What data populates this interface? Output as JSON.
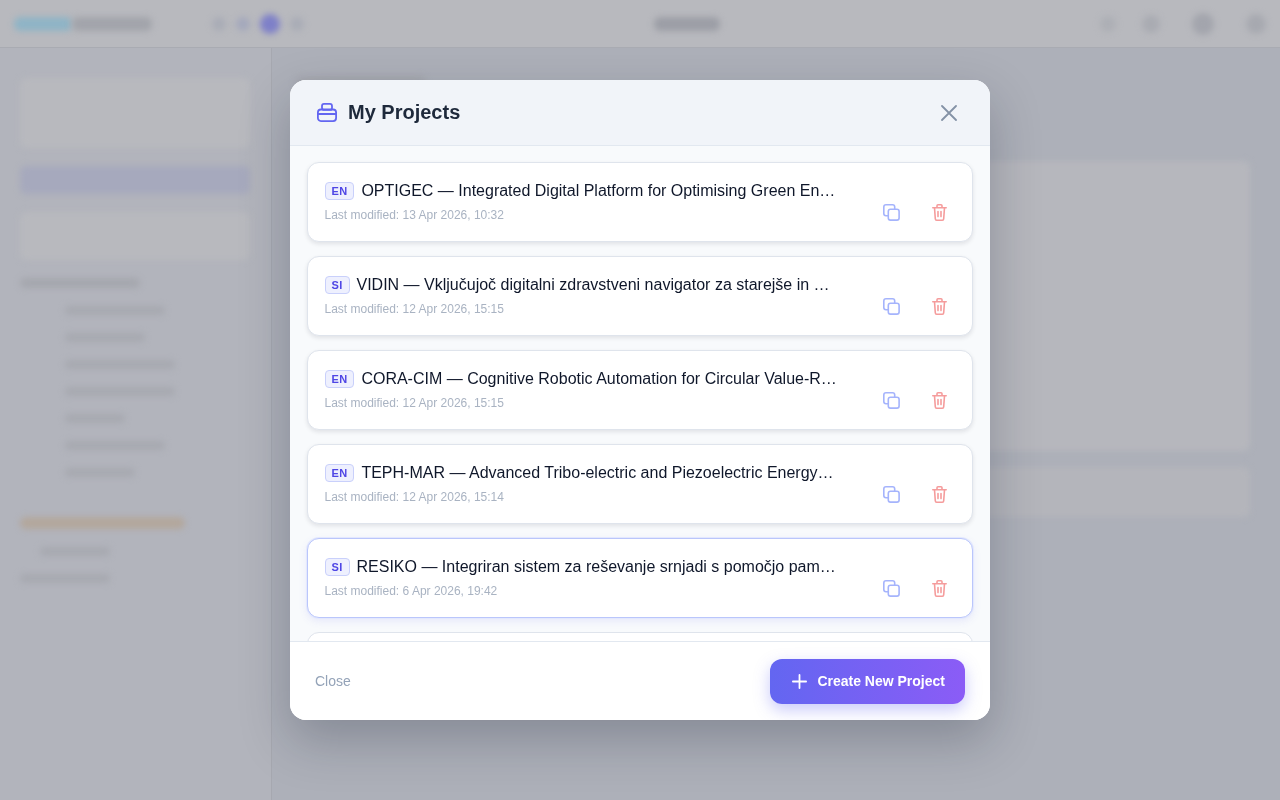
{
  "dialog": {
    "title": "My Projects",
    "projects": [
      {
        "language": "EN",
        "title": "OPTIGEC — Integrated Digital Platform for Optimising Green En…",
        "modified": "Last modified: 13 Apr 2026, 10:32",
        "selected": false
      },
      {
        "language": "SI",
        "title": "VIDIN — Vključujoč digitalni zdravstveni navigator za starejše in …",
        "modified": "Last modified: 12 Apr 2026, 15:15",
        "selected": false
      },
      {
        "language": "EN",
        "title": "CORA-CIM — Cognitive Robotic Automation for Circular Value-R…",
        "modified": "Last modified: 12 Apr 2026, 15:15",
        "selected": false
      },
      {
        "language": "EN",
        "title": "TEPH-MAR — Advanced Tribo-electric and Piezoelectric Energy…",
        "modified": "Last modified: 12 Apr 2026, 15:14",
        "selected": false
      },
      {
        "language": "SI",
        "title": "RESIKO — Integriran sistem za reševanje srnjadi s pomočjo pam…",
        "modified": "Last modified: 6 Apr 2026, 19:42",
        "selected": true
      }
    ],
    "footer": {
      "close": "Close",
      "create": "Create New Project"
    }
  }
}
